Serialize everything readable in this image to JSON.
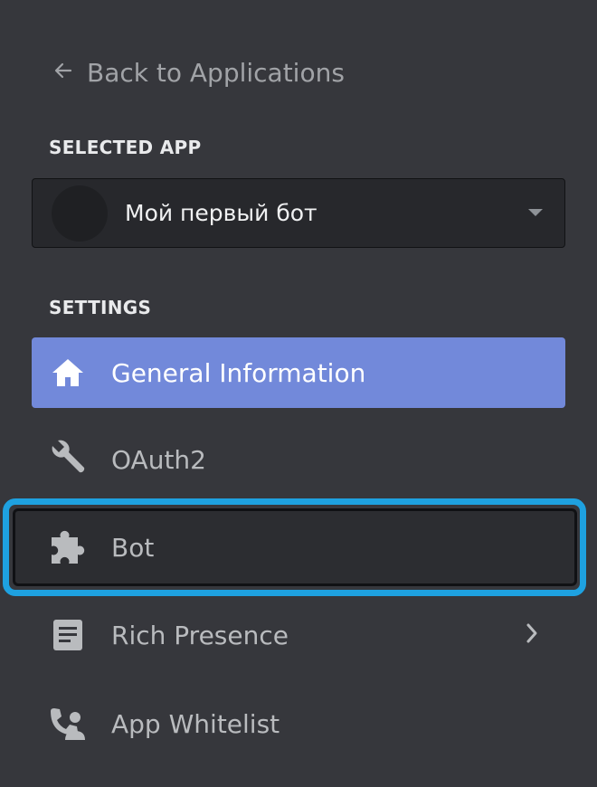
{
  "back_link": {
    "label": "Back to Applications",
    "icon": "arrow-left-icon"
  },
  "selected_app": {
    "section_label": "SELECTED APP",
    "app_name": "Мой первый бот",
    "dropdown_icon": "caret-down-icon"
  },
  "settings": {
    "section_label": "SETTINGS",
    "items": [
      {
        "label": "General Information",
        "icon": "home-icon",
        "active": true
      },
      {
        "label": "OAuth2",
        "icon": "wrench-icon",
        "active": false
      },
      {
        "label": "Bot",
        "icon": "puzzle-icon",
        "active": false,
        "highlighted": true
      },
      {
        "label": "Rich Presence",
        "icon": "document-icon",
        "active": false,
        "has_submenu": true
      },
      {
        "label": "App Whitelist",
        "icon": "person-phone-icon",
        "active": false
      }
    ]
  },
  "colors": {
    "background": "#36373c",
    "active_item": "#7289da",
    "highlight_ring": "#1ea1e0",
    "muted_text": "#b9bbbe"
  }
}
